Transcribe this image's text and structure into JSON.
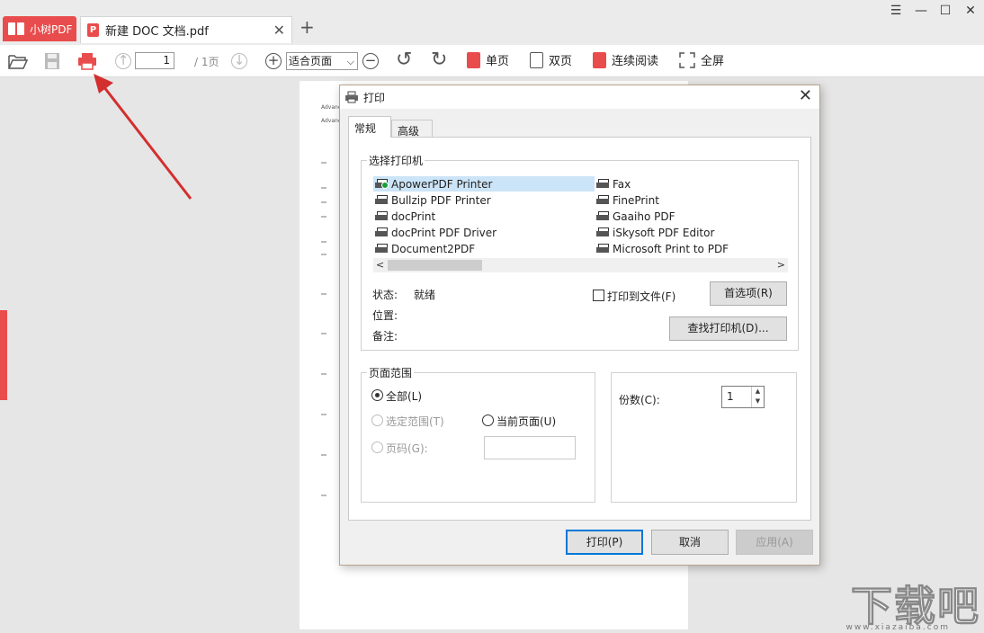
{
  "app": {
    "name": "小树PDF",
    "doc_tab": "新建 DOC 文档.pdf",
    "new_tab": "+",
    "pdf_badge": "P"
  },
  "window_controls": {
    "menu": "☰",
    "minimize": "—",
    "maximize": "☐",
    "close": "✕"
  },
  "toolbar": {
    "page_value": "1",
    "page_total": "/ 1页",
    "zoom": "适合页面",
    "single_page": "单页",
    "double_page": "双页",
    "continuous": "连续阅读",
    "fullscreen": "全屏"
  },
  "dialog": {
    "title": "打印",
    "tabs": [
      "常规",
      "高级"
    ],
    "select_printer": "选择打印机",
    "printers_left": [
      "ApowerPDF Printer",
      "Bullzip PDF Printer",
      "docPrint",
      "docPrint PDF Driver",
      "Document2PDF"
    ],
    "printers_right": [
      "Fax",
      "FinePrint",
      "Gaaiho PDF",
      "iSkysoft PDF Editor",
      "Microsoft Print to PDF"
    ],
    "selected_printer": "ApowerPDF Printer",
    "status_label": "状态:",
    "status_value": "就绪",
    "location_label": "位置:",
    "comment_label": "备注:",
    "print_to_file": "打印到文件(F)",
    "preferences": "首选项(R)",
    "find_printer": "查找打印机(D)...",
    "page_range": "页面范围",
    "range_all": "全部(L)",
    "range_selection": "选定范围(T)",
    "range_current": "当前页面(U)",
    "range_pages": "页码(G):",
    "copies_label": "份数(C):",
    "copies_value": "1",
    "print_btn": "打印(P)",
    "cancel_btn": "取消",
    "apply_btn": "应用(A)"
  },
  "page_preview_lines": [
    "Advanced",
    "Advanced"
  ],
  "watermark": "下载吧",
  "watermark_url": "www.xiazaiba.com",
  "colors": {
    "accent": "#e94c4c",
    "focus": "#0078d7",
    "selection": "#cce4f7",
    "arrow": "#d32f2f"
  }
}
